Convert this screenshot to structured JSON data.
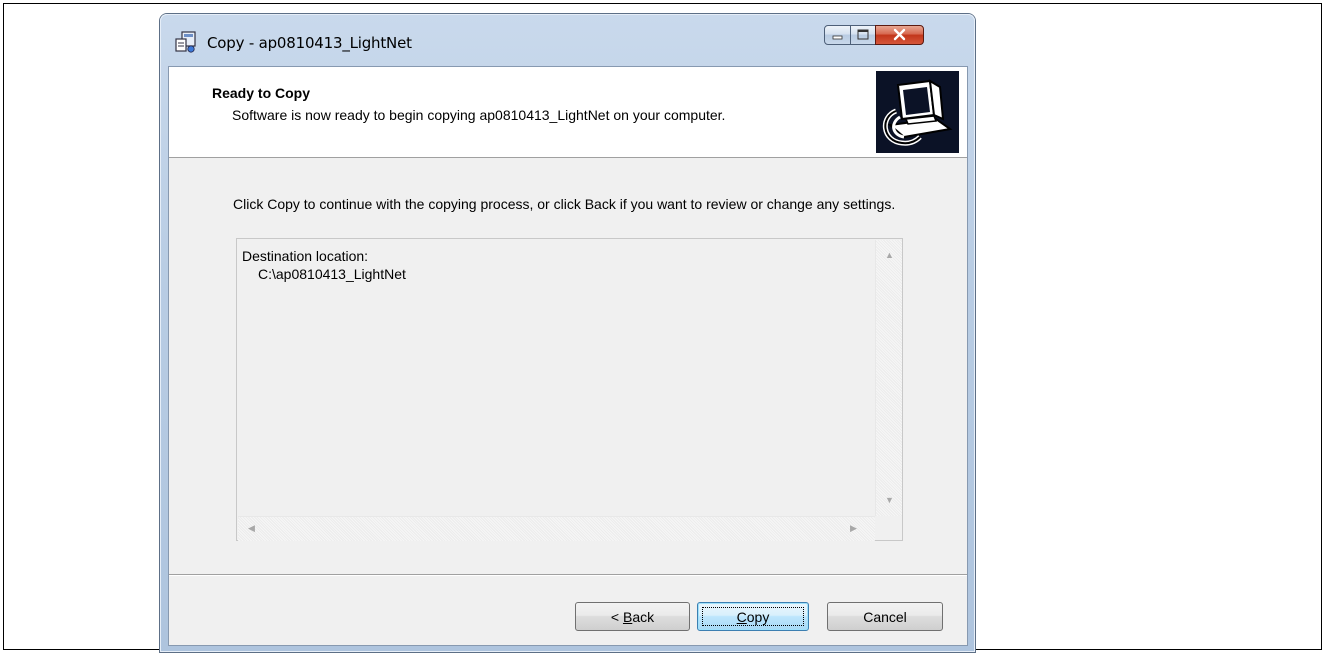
{
  "window": {
    "title": "Copy - ap0810413_LightNet",
    "caption_buttons": [
      "minimize",
      "maximize",
      "close"
    ]
  },
  "header": {
    "title": "Ready to Copy",
    "subtitle": "Software is now ready to begin copying ap0810413_LightNet on your computer."
  },
  "body": {
    "instruction": "Click Copy to continue with the copying process, or click Back if you want to review or change any settings.",
    "memo": {
      "label": "Destination location:",
      "value": "C:\\ap0810413_LightNet"
    }
  },
  "buttons": {
    "back_prefix": "< ",
    "back_accel": "B",
    "back_rest": "ack",
    "copy_accel": "C",
    "copy_rest": "opy",
    "cancel": "Cancel"
  },
  "icons": {
    "app": "installer-icon",
    "header": "computer-install-icon"
  }
}
